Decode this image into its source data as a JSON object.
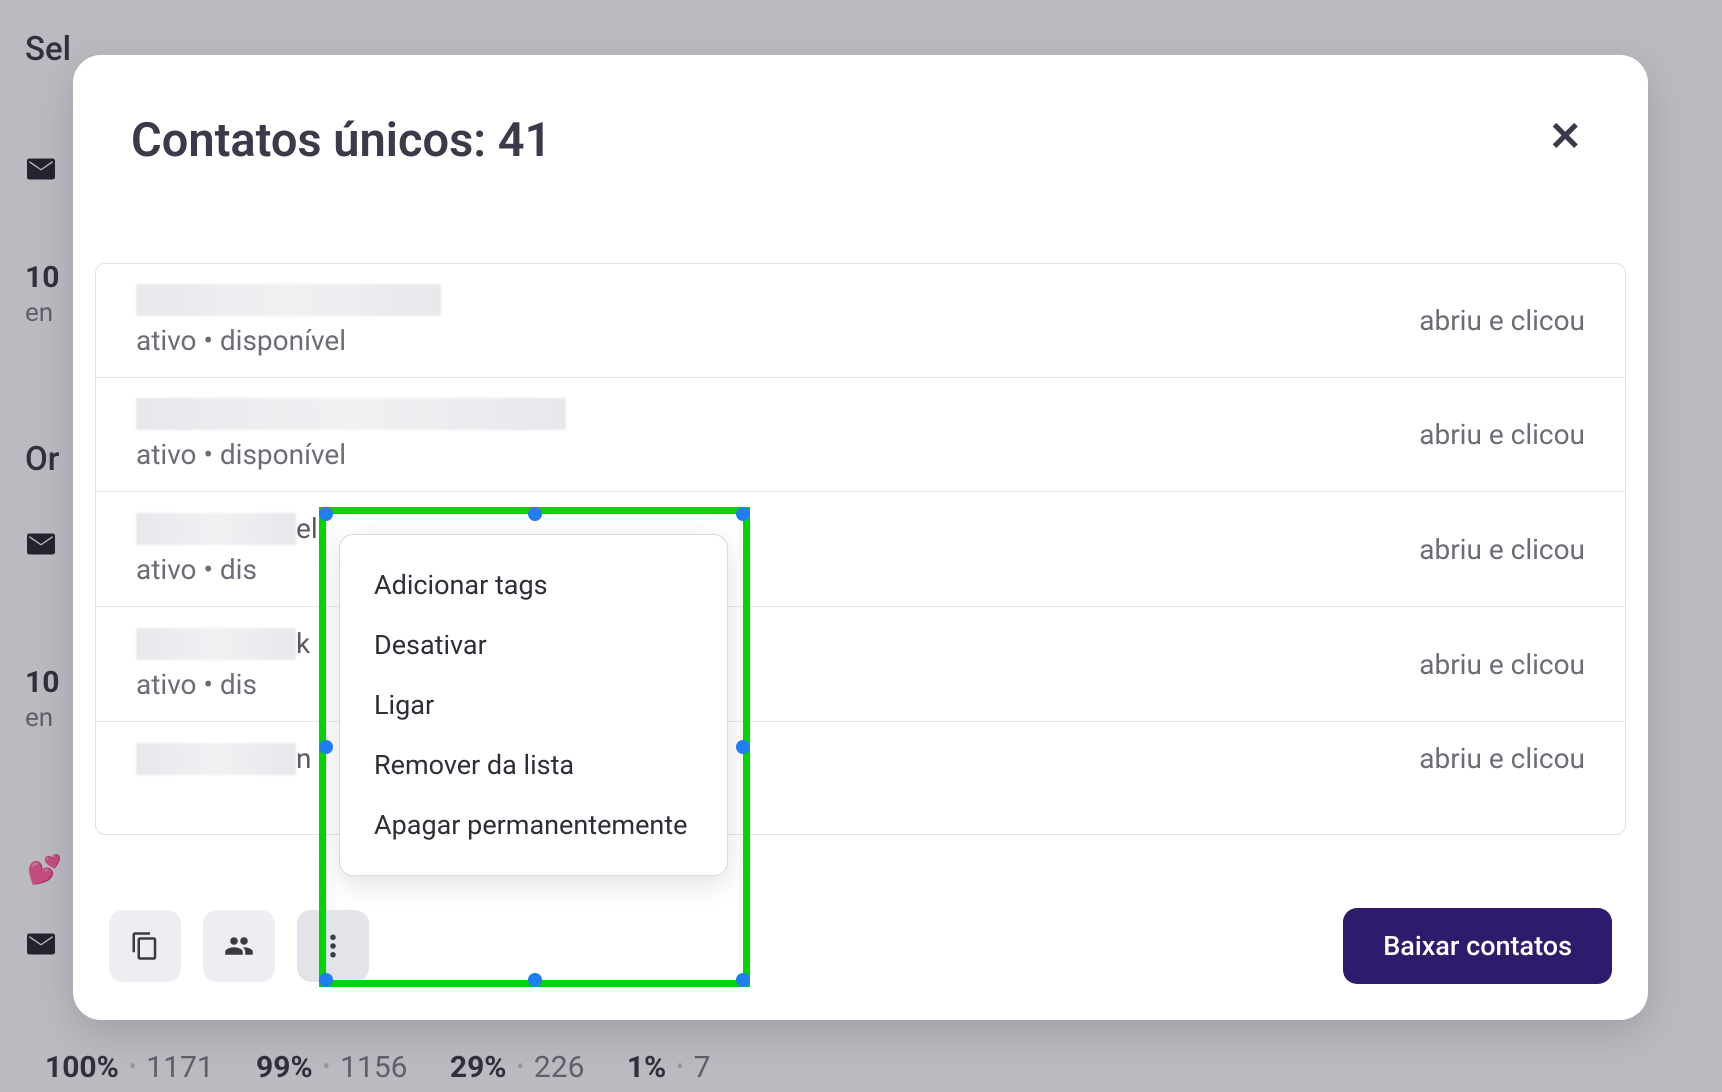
{
  "background": {
    "sel_label": "Sel",
    "or_label": "Or",
    "stat10a": "10",
    "en1": "en",
    "stat10b": "10",
    "en2": "en",
    "heart_emoji": "💕",
    "bottom_stats": {
      "p1": "100%",
      "v1": "1171",
      "p2": "99%",
      "v2": "1156",
      "p3": "29%",
      "v3": "226",
      "p4": "1%",
      "v4": "7"
    }
  },
  "modal": {
    "title": "Contatos únicos: 41",
    "close_label": "✕",
    "download_button": "Baixar contatos",
    "rows": [
      {
        "meta": "ativo  •  disponível",
        "status": "abriu e clicou"
      },
      {
        "meta": "ativo  •  disponível",
        "status": "abriu e clicou"
      },
      {
        "meta": "ativo  •  dis",
        "status": "abriu e clicou"
      },
      {
        "meta": "ativo  •  dis",
        "status": "abriu e clicou"
      },
      {
        "meta": "",
        "status": "abriu e clicou"
      }
    ]
  },
  "context_menu": {
    "items": [
      "Adicionar tags",
      "Desativar",
      "Ligar",
      "Remover da lista",
      "Apagar permanentemente"
    ]
  }
}
